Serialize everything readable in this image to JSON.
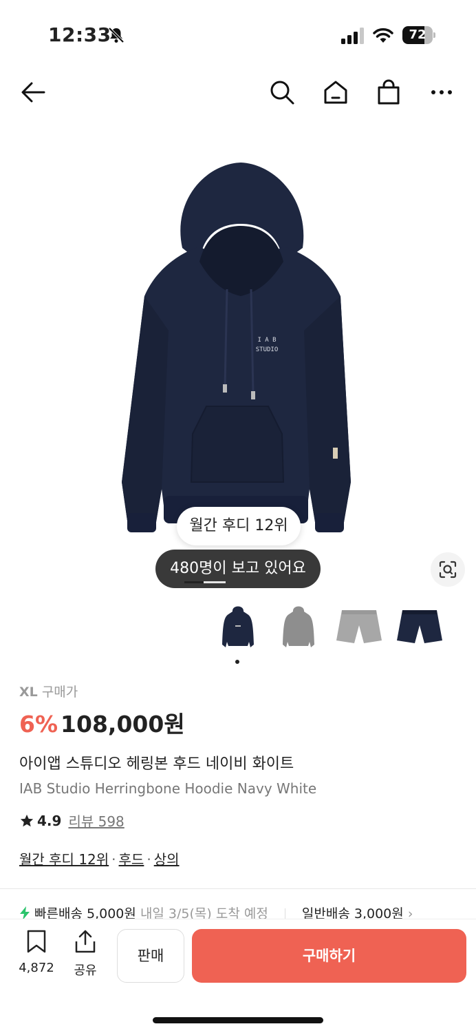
{
  "status_bar": {
    "time": "12:33",
    "battery": "72",
    "battery_level": 0.72,
    "icons": [
      "bell-off-icon",
      "signal-icon",
      "wifi-icon",
      "battery-icon"
    ]
  },
  "nav": {
    "icons": [
      "back-arrow-icon",
      "search-icon",
      "home-icon",
      "shopping-bag-icon",
      "more-icon"
    ]
  },
  "hero": {
    "ranking_badge": "월간 후디 12위",
    "viewers": "480명이 보고 있어요",
    "print_line1": "I A B",
    "print_line2": "STUDIO"
  },
  "thumbnails": [
    "navy-hoodie",
    "grey-hoodie",
    "grey-shorts",
    "navy-shorts"
  ],
  "product": {
    "size": "XL",
    "size_suffix": "구매가",
    "discount": "6%",
    "price": "108,000원",
    "name_ko": "아이앱 스튜디오 헤링본 후드 네이비 화이트",
    "name_en": "IAB Studio Herringbone Hoodie Navy White",
    "rating": "4.9",
    "reviews_label": "리뷰 598",
    "tags": [
      "월간 후디 12위",
      "후드",
      "상의"
    ]
  },
  "shipping": {
    "fast_label": "빠른배송 5,000원",
    "fast_eta": "내일 3/5(목) 도착 예정",
    "normal_label": "일반배송 3,000원"
  },
  "bottom": {
    "saves": "4,872",
    "share": "공유",
    "sell": "판매",
    "buy": "구매하기"
  },
  "colors": {
    "accent": "#ef6253",
    "garment_navy": "#1e2740"
  }
}
